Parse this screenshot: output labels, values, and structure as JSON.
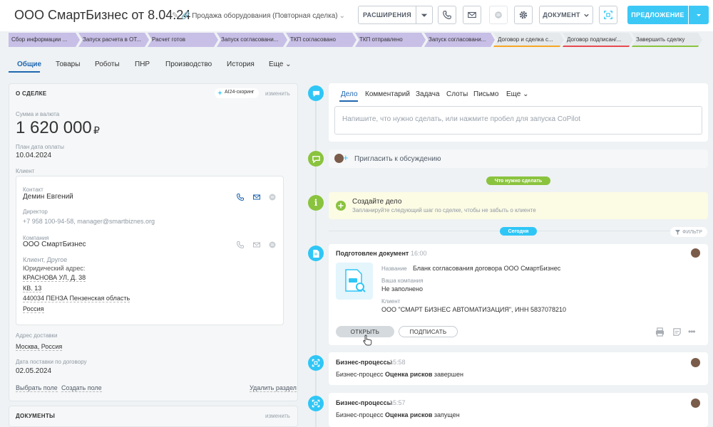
{
  "header": {
    "title": "ООО СмартБизнес от 8.04.24",
    "pencil": "✎",
    "subtitle": "🔗 Продажа оборудования (Повторная сделка)",
    "subtitle_chev": "⌄",
    "extensions_label": "РАСШИРЕНИЯ",
    "document_label": "ДОКУМЕНТ",
    "offer_label": "ПРЕДЛОЖЕНИЕ",
    "colors": {
      "primary": "#3bc8f5",
      "stage_done": "#c8bfe7",
      "stage_todo": "#e6e9ec"
    }
  },
  "stages": [
    {
      "label": "Сбор информации ..."
    },
    {
      "label": "Запуск расчета в ОТ..."
    },
    {
      "label": "Расчет готов"
    },
    {
      "label": "Запуск согласовани..."
    },
    {
      "label": "ТКП согласовано"
    },
    {
      "label": "ТКП отправлено"
    },
    {
      "label": "Запуск согласовани..."
    },
    {
      "label": "Договор и сделка с..."
    },
    {
      "label": "Договор подписан/..."
    },
    {
      "label": "Завершить сделку"
    }
  ],
  "tabs": [
    "Общие",
    "Товары",
    "Роботы",
    "ПНР",
    "Производство",
    "История",
    "Еще ⌄"
  ],
  "deal": {
    "section_title": "О СДЕЛКЕ",
    "scoring_chip": "AI24-скоринг",
    "edit": "изменить",
    "amount_label": "Сумма и валюта",
    "amount": "1 620 000",
    "currency": "₽",
    "plan_date_label": "План дата оплаты",
    "plan_date": "10.04.2024",
    "client_label": "Клиент",
    "contact_label": "Контакт",
    "contact_name": "Демин Евгений",
    "director_label": "Директор",
    "director_info": "+7 958 100-94-58, manager@smartbiznes.org",
    "company_label": "Компания",
    "company_name": "ООО СмартБизнес",
    "company_type": "Клиент, Другое",
    "legal_address_label": "Юридический адрес:",
    "address_lines": [
      "КРАСНОВА УЛ, Д. 38",
      "КВ. 13",
      "440034 ПЕНЗА Пензенская область",
      "Россия"
    ],
    "delivery_label": "Адрес доставки",
    "delivery_value": "Москва, Россия",
    "delivery_date_label": "Дата поставки по договору",
    "delivery_date": "02.05.2024",
    "select_field": "Выбрать поле",
    "create_field": "Создать поле",
    "delete_section": "Удалить раздел"
  },
  "documents": {
    "title": "ДОКУМЕНТЫ",
    "edit": "изменить"
  },
  "activity": {
    "tabs": [
      "Дело",
      "Комментарий",
      "Задача",
      "Слоты",
      "Письмо",
      "Еще ⌄"
    ],
    "placeholder": "Напишите, что нужно сделать, или нажмите пробел для запуска CoPilot",
    "invite": "Пригласить к обсуждению",
    "todo_pill": "Что нужно сделать",
    "create_title": "Создайте дело",
    "create_hint": "Запланируйте следующий шаг по сделке, чтобы не забыть о клиенте",
    "today_pill": "Сегодня",
    "filter": "ФИЛЬТР"
  },
  "doc_event": {
    "title": "Подготовлен документ",
    "time": "16:00",
    "name_label": "Название",
    "name_value": "Бланк согласования договора ООО СмартБизнес",
    "company_label": "Ваша компания",
    "company_value": "Не заполнено",
    "client_label": "Клиент",
    "client_value": "ООО \"СМАРТ БИЗНЕС АВТОМАТИЗАЦИЯ\", ИНН 5837078210",
    "open": "ОТКРЫТЬ",
    "sign": "ПОДПИСАТЬ",
    "more": "•••"
  },
  "bp_events": [
    {
      "title": "Бизнес-процессы",
      "time": "15:58",
      "prefix": "Бизнес-процесс ",
      "name": "Оценка рисков",
      "suffix": " завершен"
    },
    {
      "title": "Бизнес-процессы",
      "time": "15:57",
      "prefix": "Бизнес-процесс ",
      "name": "Оценка рисков",
      "suffix": " запущен"
    }
  ]
}
